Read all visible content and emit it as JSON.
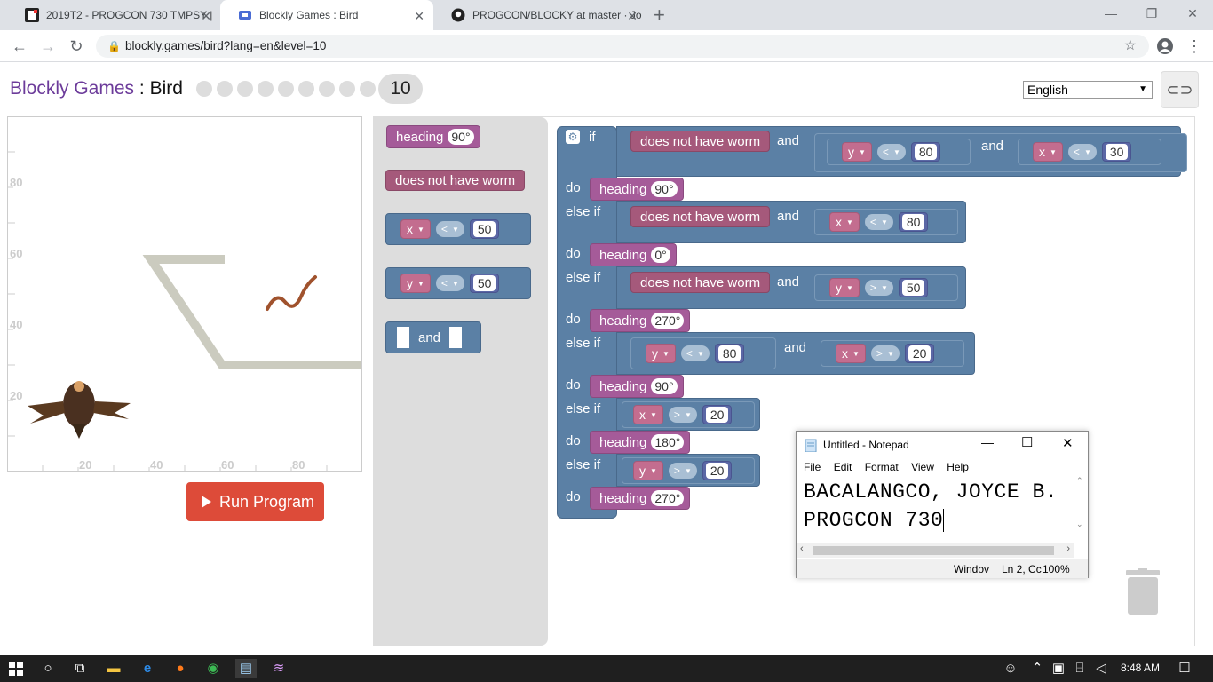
{
  "browser": {
    "tabs": [
      {
        "title": "2019T2 - PROGCON 730 TMPSY |",
        "active": false
      },
      {
        "title": "Blockly Games : Bird",
        "active": true
      },
      {
        "title": "PROGCON/BLOCKY at master · Jo",
        "active": false
      }
    ],
    "new_tab": "+",
    "url": "blockly.games/bird?lang=en&level=10"
  },
  "page": {
    "app_name": "Blockly Games",
    "separator": " : ",
    "game_name": "Bird",
    "current_level": "10",
    "language": "English",
    "run_button": "Run Program"
  },
  "stage": {
    "y_ticks": [
      "80",
      "60",
      "40",
      "20"
    ],
    "x_ticks": [
      "20",
      "40",
      "60",
      "80"
    ]
  },
  "toolbox": {
    "heading": "heading",
    "heading_value": "90°",
    "worm": "does not have worm",
    "cmp1": {
      "var": "x",
      "op": "<",
      "num": "50"
    },
    "cmp2": {
      "var": "y",
      "op": "<",
      "num": "50"
    },
    "and": "and"
  },
  "program": {
    "if": "if",
    "do": "do",
    "else_if": "else if",
    "and": "and",
    "worm": "does not have worm",
    "heading": "heading",
    "c1a": {
      "var": "y",
      "op": "<",
      "num": "80"
    },
    "c1b": {
      "var": "x",
      "op": "<",
      "num": "30"
    },
    "h1": "90°",
    "c2": {
      "var": "x",
      "op": "<",
      "num": "80"
    },
    "h2": "0°",
    "c3": {
      "var": "y",
      "op": ">",
      "num": "50"
    },
    "h3": "270°",
    "c4a": {
      "var": "y",
      "op": "<",
      "num": "80"
    },
    "c4b": {
      "var": "x",
      "op": ">",
      "num": "20"
    },
    "h4": "90°",
    "c5": {
      "var": "x",
      "op": ">",
      "num": "20"
    },
    "h5": "180°",
    "c6": {
      "var": "y",
      "op": ">",
      "num": "20"
    },
    "h6": "270°"
  },
  "notepad": {
    "title": "Untitled - Notepad",
    "menu": [
      "File",
      "Edit",
      "Format",
      "View",
      "Help"
    ],
    "line1": "BACALANGCO, JOYCE B.",
    "line2": "PROGCON 730",
    "status_eol": "Windov",
    "status_pos": "Ln 2, Cc",
    "status_zoom": "100%"
  },
  "taskbar": {
    "time": "8:48 AM"
  }
}
